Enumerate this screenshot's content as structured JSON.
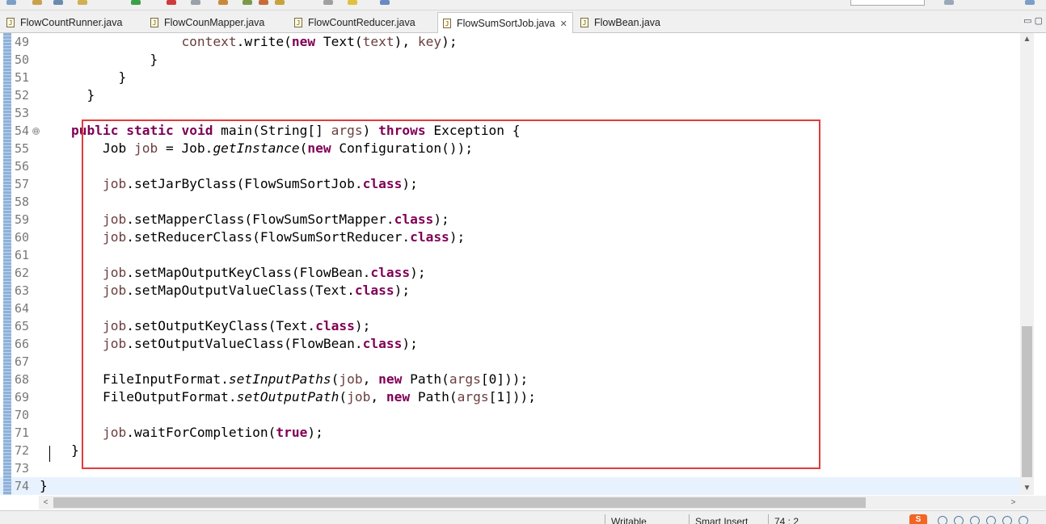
{
  "tabs": [
    {
      "label": "FlowCountRunner.java",
      "active": false
    },
    {
      "label": "FlowCounMapper.java",
      "active": false
    },
    {
      "label": "FlowCountReducer.java",
      "active": false
    },
    {
      "label": "FlowSumSortJob.java",
      "active": true
    },
    {
      "label": "FlowBean.java",
      "active": false
    }
  ],
  "tab_icon_glyph": "J",
  "tab_close_glyph": "✕",
  "tabbar_controls": "▭ ▢",
  "editor": {
    "lines": [
      {
        "n": "49"
      },
      {
        "n": "50"
      },
      {
        "n": "51"
      },
      {
        "n": "52"
      },
      {
        "n": "53"
      },
      {
        "n": "54",
        "fold": "⊖"
      },
      {
        "n": "55"
      },
      {
        "n": "56"
      },
      {
        "n": "57"
      },
      {
        "n": "58"
      },
      {
        "n": "59"
      },
      {
        "n": "60"
      },
      {
        "n": "61"
      },
      {
        "n": "62"
      },
      {
        "n": "63"
      },
      {
        "n": "64"
      },
      {
        "n": "65"
      },
      {
        "n": "66"
      },
      {
        "n": "67"
      },
      {
        "n": "68"
      },
      {
        "n": "69"
      },
      {
        "n": "70"
      },
      {
        "n": "71"
      },
      {
        "n": "72"
      },
      {
        "n": "73"
      },
      {
        "n": "74"
      }
    ],
    "tokens": [
      [
        [
          "                  ",
          ""
        ],
        [
          "context",
          "var"
        ],
        [
          ".write(",
          ""
        ],
        [
          "new",
          "kw"
        ],
        [
          " Text(",
          ""
        ],
        [
          "text",
          "var"
        ],
        [
          "), ",
          ""
        ],
        [
          "key",
          "var"
        ],
        [
          ");",
          ""
        ]
      ],
      [
        [
          "              }",
          ""
        ]
      ],
      [
        [
          "          }",
          ""
        ]
      ],
      [
        [
          "      }",
          ""
        ]
      ],
      [
        [
          "",
          ""
        ]
      ],
      [
        [
          "    ",
          ""
        ],
        [
          "public",
          "kw"
        ],
        [
          " ",
          ""
        ],
        [
          "static",
          "kw"
        ],
        [
          " ",
          ""
        ],
        [
          "void",
          "kw"
        ],
        [
          " main(String[] ",
          ""
        ],
        [
          "args",
          "var"
        ],
        [
          ") ",
          ""
        ],
        [
          "throws",
          "kw"
        ],
        [
          " Exception {",
          ""
        ]
      ],
      [
        [
          "        Job ",
          ""
        ],
        [
          "job",
          "var"
        ],
        [
          " = Job.",
          ""
        ],
        [
          "getInstance",
          "it"
        ],
        [
          "(",
          ""
        ],
        [
          "new",
          "kw"
        ],
        [
          " Configuration());",
          ""
        ]
      ],
      [
        [
          "",
          ""
        ]
      ],
      [
        [
          "        ",
          ""
        ],
        [
          "job",
          "var"
        ],
        [
          ".setJarByClass(FlowSumSortJob.",
          ""
        ],
        [
          "class",
          "kw"
        ],
        [
          ");",
          ""
        ]
      ],
      [
        [
          "",
          ""
        ]
      ],
      [
        [
          "        ",
          ""
        ],
        [
          "job",
          "var"
        ],
        [
          ".setMapperClass(FlowSumSortMapper.",
          ""
        ],
        [
          "class",
          "kw"
        ],
        [
          ");",
          ""
        ]
      ],
      [
        [
          "        ",
          ""
        ],
        [
          "job",
          "var"
        ],
        [
          ".setReducerClass(FlowSumSortReducer.",
          ""
        ],
        [
          "class",
          "kw"
        ],
        [
          ");",
          ""
        ]
      ],
      [
        [
          "",
          ""
        ]
      ],
      [
        [
          "        ",
          ""
        ],
        [
          "job",
          "var"
        ],
        [
          ".setMapOutputKeyClass(FlowBean.",
          ""
        ],
        [
          "class",
          "kw"
        ],
        [
          ");",
          ""
        ]
      ],
      [
        [
          "        ",
          ""
        ],
        [
          "job",
          "var"
        ],
        [
          ".setMapOutputValueClass(Text.",
          ""
        ],
        [
          "class",
          "kw"
        ],
        [
          ");",
          ""
        ]
      ],
      [
        [
          "",
          ""
        ]
      ],
      [
        [
          "        ",
          ""
        ],
        [
          "job",
          "var"
        ],
        [
          ".setOutputKeyClass(Text.",
          ""
        ],
        [
          "class",
          "kw"
        ],
        [
          ");",
          ""
        ]
      ],
      [
        [
          "        ",
          ""
        ],
        [
          "job",
          "var"
        ],
        [
          ".setOutputValueClass(FlowBean.",
          ""
        ],
        [
          "class",
          "kw"
        ],
        [
          ");",
          ""
        ]
      ],
      [
        [
          "",
          ""
        ]
      ],
      [
        [
          "        FileInputFormat.",
          ""
        ],
        [
          "setInputPaths",
          "it"
        ],
        [
          "(",
          ""
        ],
        [
          "job",
          "var"
        ],
        [
          ", ",
          ""
        ],
        [
          "new",
          "kw"
        ],
        [
          " Path(",
          ""
        ],
        [
          "args",
          "var"
        ],
        [
          "[0]));",
          ""
        ]
      ],
      [
        [
          "        FileOutputFormat.",
          ""
        ],
        [
          "setOutputPath",
          "it"
        ],
        [
          "(",
          ""
        ],
        [
          "job",
          "var"
        ],
        [
          ", ",
          ""
        ],
        [
          "new",
          "kw"
        ],
        [
          " Path(",
          ""
        ],
        [
          "args",
          "var"
        ],
        [
          "[1]));",
          ""
        ]
      ],
      [
        [
          "",
          ""
        ]
      ],
      [
        [
          "        ",
          ""
        ],
        [
          "job",
          "var"
        ],
        [
          ".waitForCompletion(",
          ""
        ],
        [
          "true",
          "kw"
        ],
        [
          ");",
          ""
        ]
      ],
      [
        [
          "    }",
          ""
        ]
      ],
      [
        [
          "",
          ""
        ]
      ],
      [
        [
          "}",
          ""
        ]
      ]
    ],
    "current_line": "74"
  },
  "scroll_arrows": {
    "up": "▲",
    "down": "▼",
    "left": "<",
    "right": ">"
  },
  "status": {
    "writable": "Writable",
    "insert_mode": "Smart Insert",
    "position": "74 : 2",
    "logo": "S"
  },
  "colors": {
    "keyword": "#7f0055",
    "variable": "#6a3e3e",
    "line_number": "#787878",
    "highlight_box": "#e43a3a",
    "current_line_bg": "#e8f2fe"
  }
}
